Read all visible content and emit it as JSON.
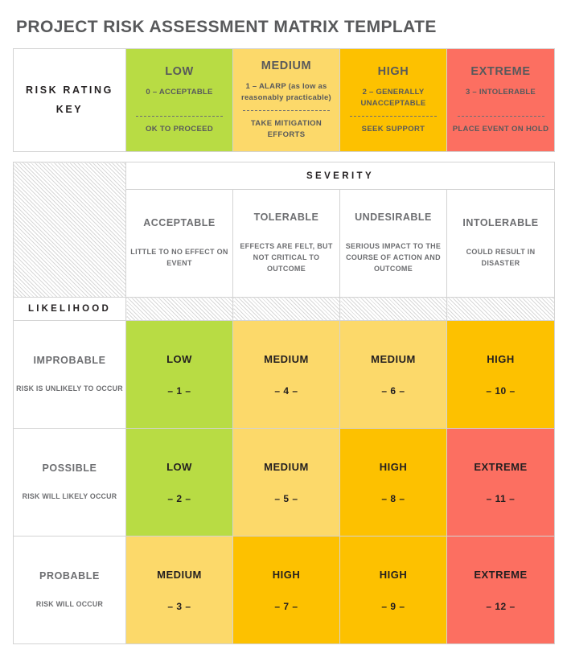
{
  "title": "PROJECT RISK ASSESSMENT MATRIX TEMPLATE",
  "colors": {
    "low": "#b8dc44",
    "medium_light": "#fcd96a",
    "high": "#fdc100",
    "extreme": "#fc6f61",
    "text_gray": "#58595b",
    "text_dark": "#231f20",
    "border": "#d3d3d3"
  },
  "key": {
    "label": "RISK RATING KEY",
    "items": [
      {
        "rating": "LOW",
        "code": "0 – ACCEPTABLE",
        "action": "OK TO PROCEED",
        "color": "#b8dc44"
      },
      {
        "rating": "MEDIUM",
        "code": "1 – ALARP (as low as reasonably practicable)",
        "action": "TAKE MITIGATION EFFORTS",
        "color": "#fcd96a"
      },
      {
        "rating": "HIGH",
        "code": "2 – GENERALLY UNACCEPTABLE",
        "action": "SEEK SUPPORT",
        "color": "#fdc100"
      },
      {
        "rating": "EXTREME",
        "code": "3 – INTOLERABLE",
        "action": "PLACE EVENT ON HOLD",
        "color": "#fc6f61"
      }
    ]
  },
  "matrix": {
    "severity_label": "SEVERITY",
    "likelihood_label": "LIKELIHOOD",
    "severity_columns": [
      {
        "name": "ACCEPTABLE",
        "desc": "LITTLE TO NO EFFECT ON EVENT"
      },
      {
        "name": "TOLERABLE",
        "desc": "EFFECTS ARE FELT, BUT NOT CRITICAL TO OUTCOME"
      },
      {
        "name": "UNDESIRABLE",
        "desc": "SERIOUS IMPACT TO THE COURSE OF ACTION AND OUTCOME"
      },
      {
        "name": "INTOLERABLE",
        "desc": "COULD RESULT IN DISASTER"
      }
    ],
    "rows": [
      {
        "name": "IMPROBABLE",
        "desc": "RISK IS UNLIKELY TO OCCUR",
        "cells": [
          {
            "rating": "LOW",
            "number": "– 1 –",
            "color": "#b8dc44"
          },
          {
            "rating": "MEDIUM",
            "number": "– 4 –",
            "color": "#fcd96a"
          },
          {
            "rating": "MEDIUM",
            "number": "– 6 –",
            "color": "#fcd96a"
          },
          {
            "rating": "HIGH",
            "number": "– 10 –",
            "color": "#fdc100"
          }
        ]
      },
      {
        "name": "POSSIBLE",
        "desc": "RISK WILL LIKELY OCCUR",
        "cells": [
          {
            "rating": "LOW",
            "number": "– 2 –",
            "color": "#b8dc44"
          },
          {
            "rating": "MEDIUM",
            "number": "– 5 –",
            "color": "#fcd96a"
          },
          {
            "rating": "HIGH",
            "number": "– 8 –",
            "color": "#fdc100"
          },
          {
            "rating": "EXTREME",
            "number": "– 11 –",
            "color": "#fc6f61"
          }
        ]
      },
      {
        "name": "PROBABLE",
        "desc": "RISK WILL OCCUR",
        "cells": [
          {
            "rating": "MEDIUM",
            "number": "– 3 –",
            "color": "#fcd96a"
          },
          {
            "rating": "HIGH",
            "number": "– 7 –",
            "color": "#fdc100"
          },
          {
            "rating": "HIGH",
            "number": "– 9 –",
            "color": "#fdc100"
          },
          {
            "rating": "EXTREME",
            "number": "– 12 –",
            "color": "#fc6f61"
          }
        ]
      }
    ]
  }
}
